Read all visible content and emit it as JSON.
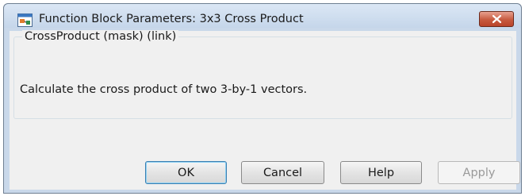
{
  "window": {
    "title": "Function Block Parameters: 3x3 Cross Product",
    "icon": "simulink-block-icon",
    "close_icon": "close-icon"
  },
  "mask": {
    "group_label": "CrossProduct (mask) (link)",
    "description": "Calculate the cross product of two 3-by-1 vectors."
  },
  "buttons": {
    "ok": "OK",
    "cancel": "Cancel",
    "help": "Help",
    "apply": "Apply"
  },
  "colors": {
    "close_button": "#c75a3f",
    "default_button_border": "#3c7fb1"
  }
}
